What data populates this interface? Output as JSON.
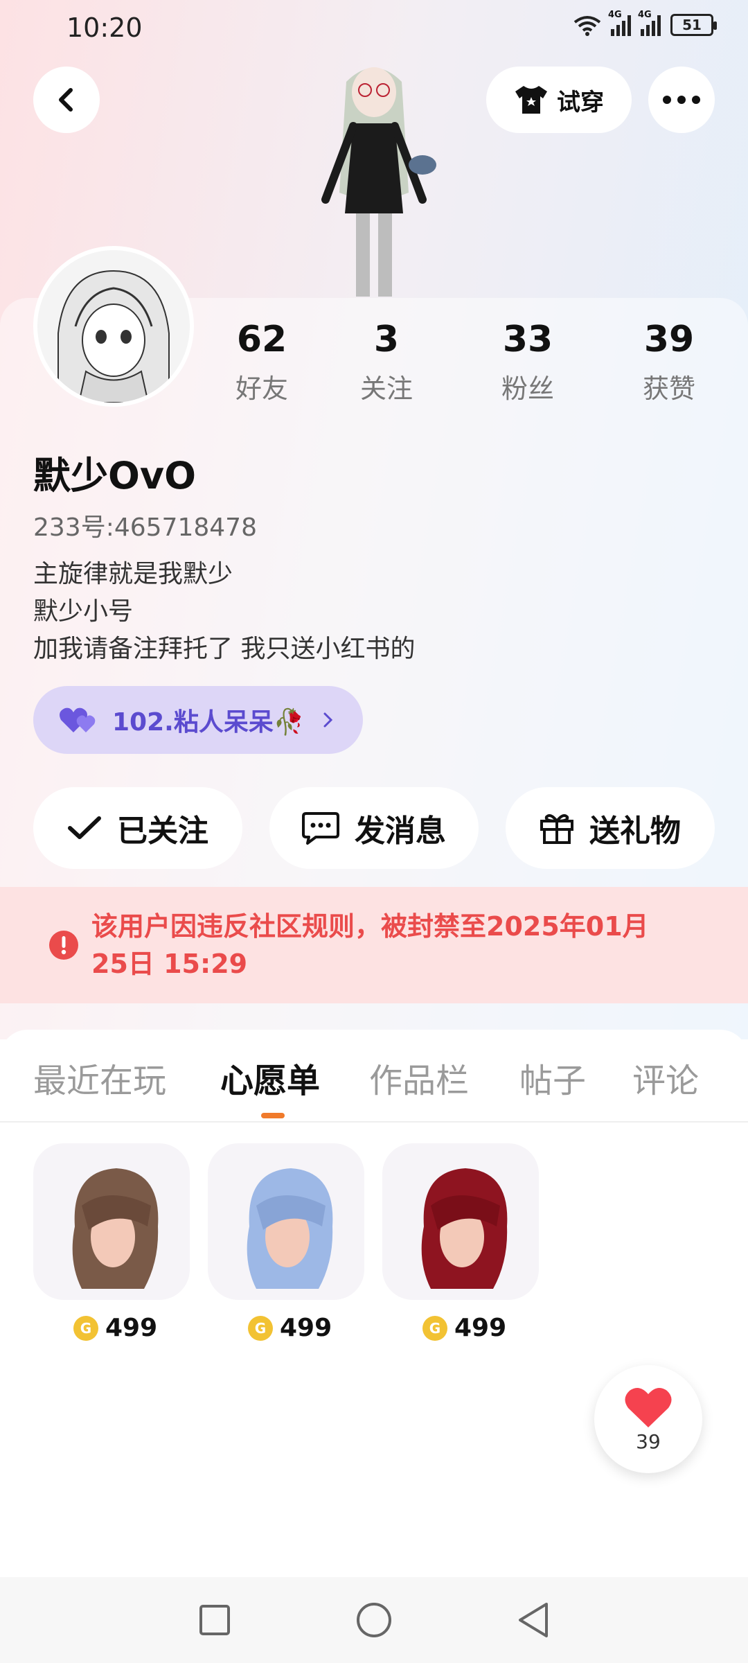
{
  "status_bar": {
    "time": "10:20",
    "network_1": "4G",
    "network_2": "4G",
    "battery": "51"
  },
  "top_bar": {
    "try_on_label": "试穿"
  },
  "profile": {
    "stats": [
      {
        "value": "62",
        "label": "好友"
      },
      {
        "value": "3",
        "label": "关注"
      },
      {
        "value": "33",
        "label": "粉丝"
      },
      {
        "value": "39",
        "label": "获赞"
      }
    ],
    "username": "默少OvO",
    "uid": "233号:465718478",
    "bio": [
      "主旋律就是我默少",
      "默少小号",
      "加我请备注拜托了 我只送小红书的"
    ],
    "guild": {
      "label": "102.粘人呆呆🥀",
      "accent": "#5b4bcf"
    }
  },
  "actions": {
    "follow_label": "已关注",
    "message_label": "发消息",
    "gift_label": "送礼物"
  },
  "ban_notice": {
    "text_line1": "该用户因违反社区规则，被封禁至2025年01月",
    "text_line2": "25日 15:29",
    "color": "#ea4b4b"
  },
  "tabs": [
    {
      "label": "最近在玩",
      "active": false
    },
    {
      "label": "心愿单",
      "active": true
    },
    {
      "label": "作品栏",
      "active": false
    },
    {
      "label": "帖子",
      "active": false
    },
    {
      "label": "评论",
      "active": false
    }
  ],
  "wishlist": [
    {
      "name": "brown-hair",
      "price": "499",
      "hair_color": "#7a5a48"
    },
    {
      "name": "blue-hair",
      "price": "499",
      "hair_color": "#9db8e6"
    },
    {
      "name": "red-hair",
      "price": "499",
      "hair_color": "#8e1420"
    }
  ],
  "like": {
    "count": "39"
  },
  "colors": {
    "accent_orange": "#f07a2b",
    "coin": "#f2c233",
    "heart": "#f5424f"
  }
}
